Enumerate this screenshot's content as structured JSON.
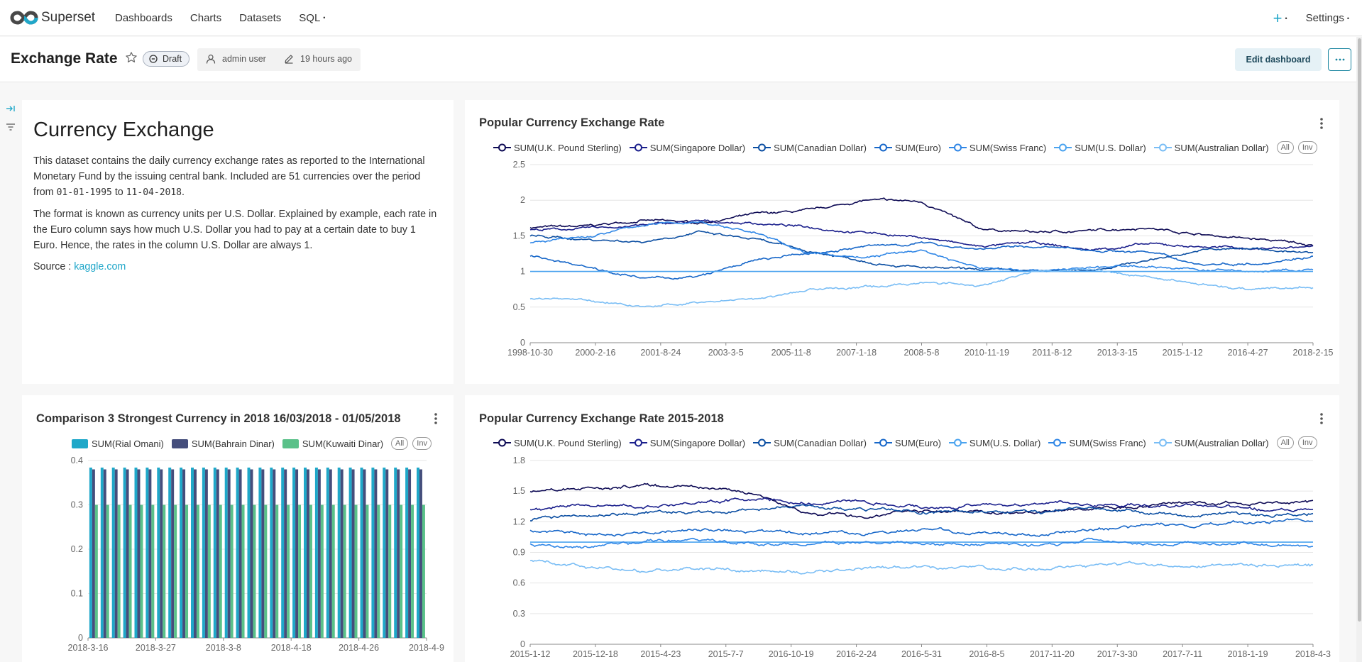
{
  "app": {
    "brand": "Superset"
  },
  "nav": {
    "items": [
      {
        "label": "Dashboards"
      },
      {
        "label": "Charts"
      },
      {
        "label": "Datasets"
      },
      {
        "label": "SQL"
      }
    ],
    "settings_label": "Settings"
  },
  "header": {
    "title": "Exchange Rate",
    "status": "Draft",
    "owner": "admin user",
    "modified": "19 hours ago",
    "edit_label": "Edit dashboard"
  },
  "markdown": {
    "heading": "Currency Exchange",
    "p1_a": "This dataset contains the daily currency exchange rates as reported to the International Monetary Fund by the issuing central bank. Included are 51 currencies over the period from ",
    "p1_date1": "01-01-1995",
    "p1_b": " to ",
    "p1_date2": "11-04-2018",
    "p1_c": ".",
    "p2": "The format is known as currency units per U.S. Dollar. Explained by example, each rate in the Euro column says how much U.S. Dollar you had to pay at a certain date to buy 1 Euro. Hence, the rates in the column U.S. Dollar are always 1.",
    "source_label": "Source : ",
    "source_link": "kaggle.com"
  },
  "legend_controls": {
    "all": "All",
    "inv": "Inv"
  },
  "chart_data": [
    {
      "type": "line",
      "title": "Popular Currency Exchange Rate",
      "ylim": [
        0,
        2.5
      ],
      "yticks": [
        "0",
        "0.5",
        "1",
        "1.5",
        "2",
        "2.5"
      ],
      "xticks": [
        "1998-10-30",
        "2000-2-16",
        "2001-8-24",
        "2003-3-5",
        "2005-11-8",
        "2007-1-18",
        "2008-5-8",
        "2010-11-19",
        "2011-8-12",
        "2013-3-15",
        "2015-1-12",
        "2016-4-27",
        "2018-2-15"
      ],
      "series": [
        {
          "name": "SUM(U.K. Pound Sterling)",
          "color": "#0d0a54",
          "values": [
            1.62,
            1.63,
            1.72,
            1.68,
            1.8,
            1.85,
            2.0,
            1.98,
            1.6,
            1.55,
            1.57,
            1.62,
            1.52,
            1.45,
            1.38
          ]
        },
        {
          "name": "SUM(Singapore Dollar)",
          "color": "#1a1f8c",
          "values": [
            1.58,
            1.6,
            1.65,
            1.7,
            1.68,
            1.62,
            1.55,
            1.48,
            1.35,
            1.4,
            1.3,
            1.38,
            1.35,
            1.32,
            1.35
          ]
        },
        {
          "name": "SUM(Canadian Dollar)",
          "color": "#0b4ea2",
          "values": [
            1.5,
            1.45,
            1.42,
            1.55,
            1.45,
            1.28,
            1.15,
            1.05,
            1.02,
            1.0,
            1.02,
            1.15,
            1.3,
            1.32,
            1.25
          ]
        },
        {
          "name": "SUM(Euro)",
          "color": "#1767c9",
          "values": [
            1.22,
            1.08,
            0.9,
            0.92,
            1.15,
            1.25,
            1.35,
            1.4,
            1.32,
            1.35,
            1.3,
            1.28,
            1.1,
            1.12,
            1.22
          ]
        },
        {
          "name": "SUM(Swiss Franc)",
          "color": "#2f86e6",
          "values": [
            1.4,
            1.48,
            1.65,
            1.7,
            1.55,
            1.25,
            1.2,
            1.3,
            1.05,
            1.02,
            1.05,
            1.08,
            1.02,
            1.0,
            1.02
          ]
        },
        {
          "name": "SUM(U.S. Dollar)",
          "color": "#4aa3ef",
          "values": [
            1.0,
            1.0,
            1.0,
            1.0,
            1.0,
            1.0,
            1.0,
            1.0,
            1.0,
            1.0,
            1.0,
            1.0,
            1.0,
            1.0,
            1.0
          ]
        },
        {
          "name": "SUM(Australian Dollar)",
          "color": "#79bdf5",
          "values": [
            0.62,
            0.6,
            0.52,
            0.54,
            0.62,
            0.75,
            0.78,
            0.85,
            0.8,
            1.0,
            1.02,
            0.92,
            0.82,
            0.75,
            0.78
          ]
        }
      ]
    },
    {
      "type": "bar",
      "title": "Comparison 3 Strongest Currency in 2018 16/03/2018 - 01/05/2018",
      "ylim": [
        0,
        0.4
      ],
      "yticks": [
        "0",
        "0.1",
        "0.2",
        "0.3",
        "0.4"
      ],
      "xticks": [
        "2018-3-16",
        "2018-3-27",
        "2018-3-8",
        "2018-4-18",
        "2018-4-26",
        "2018-4-9"
      ],
      "bar_count": 30,
      "series": [
        {
          "name": "SUM(Rial Omani)",
          "color": "#1fa8c9",
          "values": [
            0.384
          ]
        },
        {
          "name": "SUM(Bahrain Dinar)",
          "color": "#454e7c",
          "values": [
            0.38
          ]
        },
        {
          "name": "SUM(Kuwaiti Dinar)",
          "color": "#5ac189",
          "values": [
            0.3
          ]
        }
      ]
    },
    {
      "type": "line",
      "title": "Popular Currency Exchange Rate 2015-2018",
      "ylim": [
        0,
        1.8
      ],
      "yticks": [
        "0",
        "0.3",
        "0.6",
        "0.9",
        "1.2",
        "1.5",
        "1.8"
      ],
      "xticks": [
        "2015-1-12",
        "2015-12-18",
        "2015-4-23",
        "2015-7-7",
        "2016-10-19",
        "2016-2-24",
        "2016-5-31",
        "2016-8-5",
        "2017-11-20",
        "2017-3-30",
        "2017-7-11",
        "2018-1-19",
        "2018-4-3"
      ],
      "series": [
        {
          "name": "SUM(U.K. Pound Sterling)",
          "color": "#0d0a54",
          "values": [
            1.5,
            1.52,
            1.55,
            1.55,
            1.48,
            1.28,
            1.25,
            1.3,
            1.3,
            1.28,
            1.32,
            1.35,
            1.38,
            1.38,
            1.4
          ]
        },
        {
          "name": "SUM(Singapore Dollar)",
          "color": "#1a1f8c",
          "values": [
            1.32,
            1.38,
            1.35,
            1.4,
            1.42,
            1.38,
            1.4,
            1.35,
            1.35,
            1.38,
            1.38,
            1.35,
            1.35,
            1.32,
            1.32
          ]
        },
        {
          "name": "SUM(Canadian Dollar)",
          "color": "#0b4ea2",
          "values": [
            1.22,
            1.25,
            1.3,
            1.28,
            1.32,
            1.35,
            1.32,
            1.3,
            1.3,
            1.3,
            1.33,
            1.28,
            1.26,
            1.25,
            1.28
          ]
        },
        {
          "name": "SUM(Euro)",
          "color": "#1767c9",
          "values": [
            1.12,
            1.08,
            1.1,
            1.12,
            1.1,
            1.08,
            1.1,
            1.12,
            1.08,
            1.08,
            1.12,
            1.15,
            1.18,
            1.2,
            1.22
          ]
        },
        {
          "name": "SUM(U.S. Dollar)",
          "color": "#4aa3ef",
          "values": [
            1.0,
            1.0,
            1.0,
            1.0,
            1.0,
            1.0,
            1.0,
            1.0,
            1.0,
            1.0,
            1.0,
            1.0,
            1.0,
            1.0,
            1.0
          ]
        },
        {
          "name": "SUM(Swiss Franc)",
          "color": "#2f86e6",
          "values": [
            0.98,
            0.95,
            1.0,
            1.02,
            0.98,
            0.98,
            1.0,
            0.98,
            0.98,
            0.97,
            1.02,
            1.0,
            0.99,
            0.98,
            0.97
          ]
        },
        {
          "name": "SUM(Australian Dollar)",
          "color": "#79bdf5",
          "values": [
            0.82,
            0.75,
            0.72,
            0.73,
            0.72,
            0.7,
            0.73,
            0.75,
            0.75,
            0.74,
            0.76,
            0.78,
            0.78,
            0.76,
            0.77
          ]
        }
      ]
    }
  ]
}
